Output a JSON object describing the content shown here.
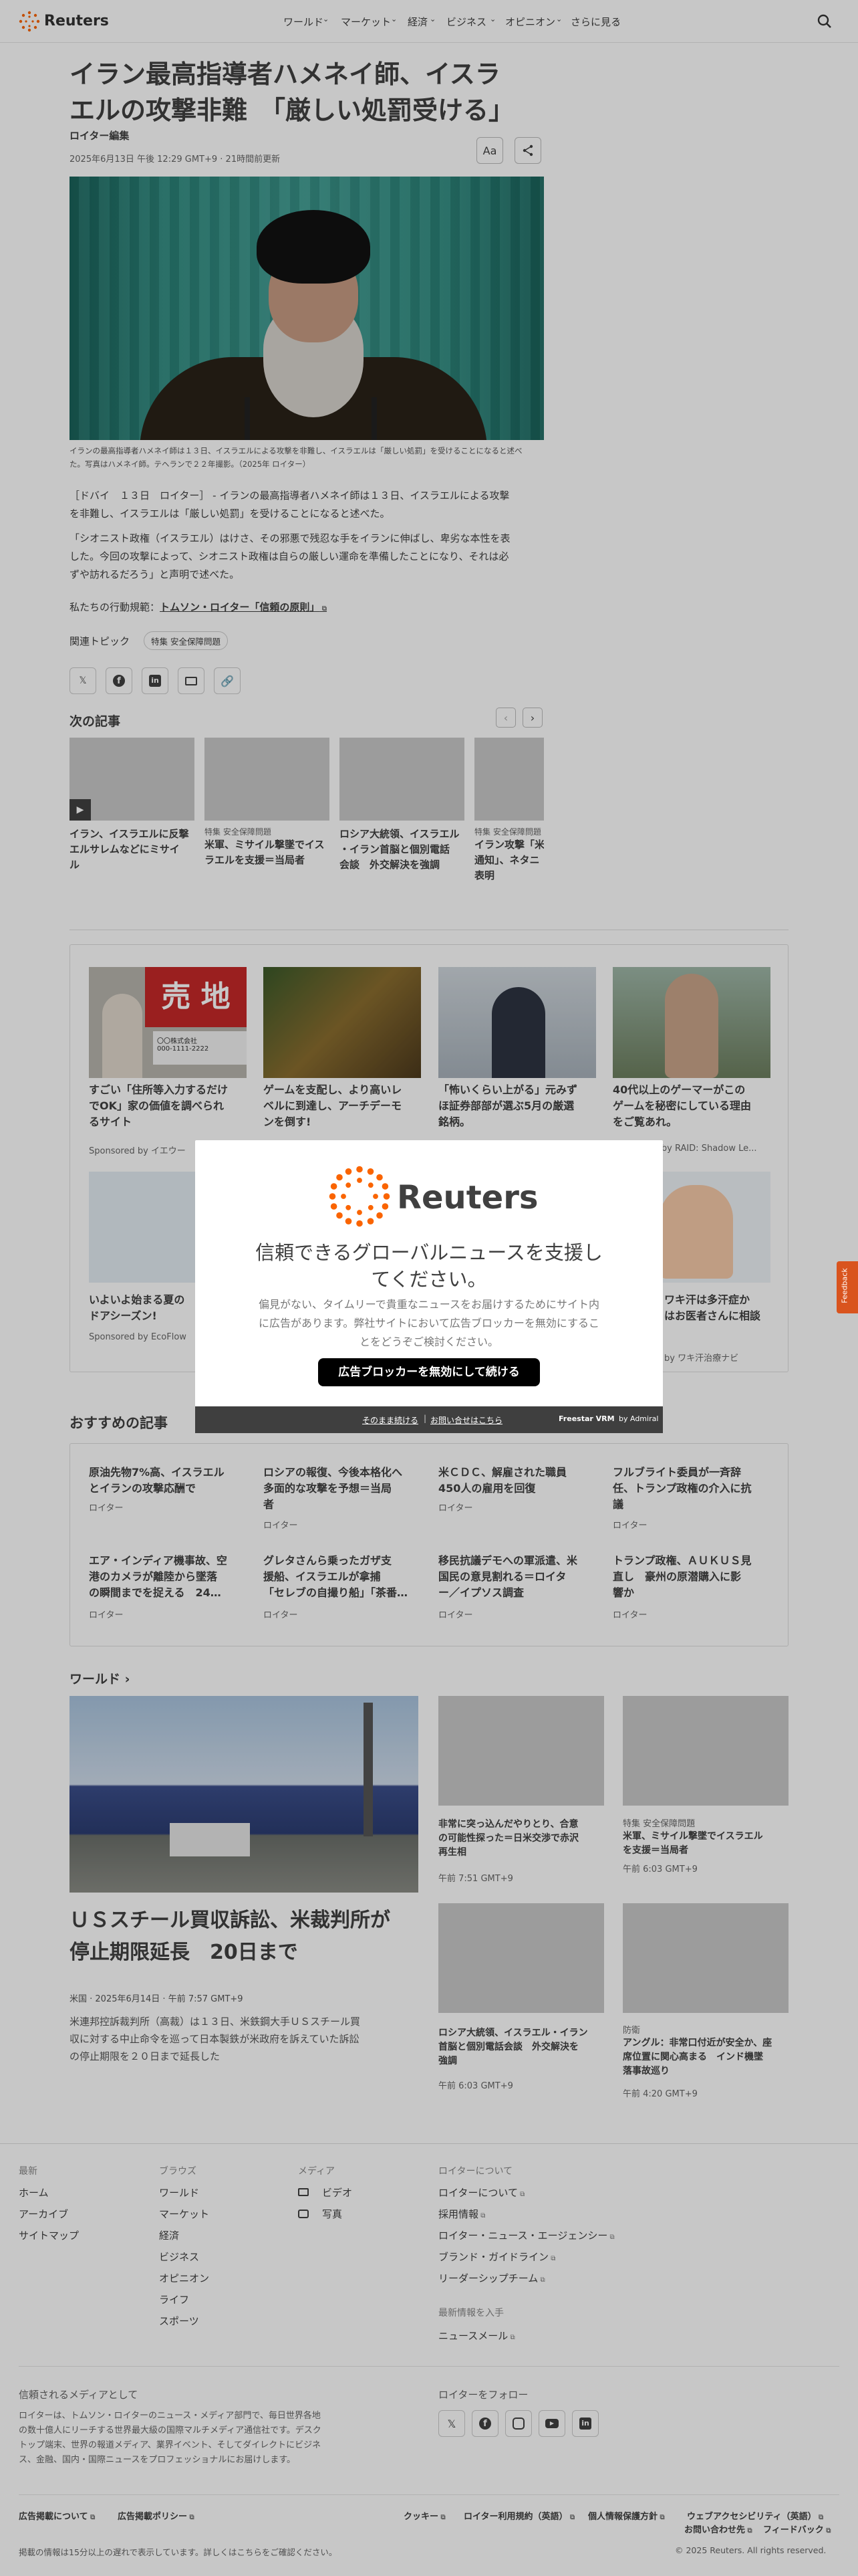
{
  "header": {
    "logo": "Reuters",
    "nav": [
      "ワールド",
      "マーケット",
      "経済",
      "ビジネス",
      "オピニオン",
      "さらに見る"
    ]
  },
  "article": {
    "title_line1": "イラン最高指導者ハメネイ師、イスラ",
    "title_line2": "エルの攻撃非難　「厳しい処罰受ける」",
    "byline": "ロイター編集",
    "date": "2025年6月13日 午後 12:29 GMT+9 · 21時間前更新",
    "font_btn": "Aa",
    "caption_line1": "イランの最高指導者ハメネイ師は１３日、イスラエルによる攻撃を非難し、イスラエルは「厳しい処罰」を受けることになると述べ",
    "caption_line2": "た。写真はハメネイ師。テヘランで２２年撮影。（2025年 ロイター）",
    "para1_line1": "［ドバイ　１３日　ロイター］ - イランの最高指導者ハメネイ師は１３日、イスラエルによる攻撃",
    "para1_line2": "を非難し、イスラエルは「厳しい処罰」を受けることになると述べた。",
    "para2_line1": "「シオニスト政権（イスラエル）はけさ、その邪悪で残忍な手をイランに伸ばし、卑劣な本性を表",
    "para2_line2": "した。今回の攻撃によって、シオニスト政権は自らの厳しい運命を準備したことになり、それは必",
    "para2_line3": "ずや訪れるだろう」と声明で述べた。",
    "principles_prefix": "私たちの行動規範：",
    "principles_link": "トムソン・ロイター「信頼の原則」",
    "topics_label": "関連トピック",
    "topic_tag": "特集 安全保障問題"
  },
  "next": {
    "heading": "次の記事",
    "items": [
      {
        "kicker": "",
        "title1": "イラン、イスラエルに反撃",
        "title2": "エルサレムなどにミサイ",
        "title3": "ル"
      },
      {
        "kicker": "特集 安全保障問題",
        "title1": "米軍、ミサイル撃墜でイス",
        "title2": "ラエルを支援＝当局者",
        "title3": ""
      },
      {
        "kicker": "",
        "title1": "ロシア大統領、イスラエル",
        "title2": "・イラン首脳と個別電話",
        "title3": "会談　外交解決を強調"
      },
      {
        "kicker": "特集 安全保障問題",
        "title1": "イラン攻撃「米",
        "title2": "通知」、ネタニ",
        "title3": "表明"
      }
    ]
  },
  "ads": [
    {
      "title1": "すごい「住所等入力するだけ",
      "title2": "でOK」家の価値を調べられ",
      "title3": "るサイト",
      "sponsor": "Sponsored by イエウー"
    },
    {
      "title1": "ゲームを支配し、より高いレ",
      "title2": "ベルに到達し、アーチデーモ",
      "title3": "ンを倒す!",
      "sponsor": ""
    },
    {
      "title1": "「怖いくらい上がる」元みず",
      "title2": "ほ証券部部が選ぶ5月の厳選",
      "title3": "銘柄。",
      "sponsor": ""
    },
    {
      "title1": "40代以上のゲーマーがこの",
      "title2": "ゲームを秘密にしている理由",
      "title3": "をご覧あれ。",
      "sponsor": "Sponsored by RAID: Shadow Le..."
    },
    {
      "title1": "いよいよ始まる夏の",
      "title2": "ドアシーズン!",
      "title3": "",
      "sponsor": "Sponsored by EcoFlow"
    },
    {
      "title1": "",
      "title2": "",
      "title3": "",
      "sponsor": ""
    },
    {
      "title1": "",
      "title2": "",
      "title3": "",
      "sponsor": ""
    },
    {
      "title1": "ワキ汗は多汗症か",
      "title2": "はお医者さんに相談",
      "title3": "",
      "sponsor": "by ワキ汗治療ナビ"
    }
  ],
  "ad_sign": "売 地",
  "ad_phone": "000-1111-2222",
  "ad_company": "〇〇株式会社",
  "recommended": {
    "heading": "おすすめの記事",
    "items": [
      {
        "t1": "原油先物7%高、イスラエル",
        "t2": "とイランの攻撃応酬で",
        "src": "ロイター"
      },
      {
        "t1": "ロシアの報復、今後本格化へ",
        "t2": "多面的な攻撃を予想＝当局",
        "t3": "者",
        "src": "ロイター"
      },
      {
        "t1": "米ＣＤＣ、解雇された職員",
        "t2": "450人の雇用を回復",
        "src": "ロイター"
      },
      {
        "t1": "フルブライト委員が一斉辞",
        "t2": "任、トランプ政権の介入に抗",
        "t3": "議",
        "src": "ロイター"
      },
      {
        "t1": "エア・インディア機事故、空",
        "t2": "港のカメラが離陸から墜落",
        "t3": "の瞬間までを捉える　24…",
        "src": "ロイター"
      },
      {
        "t1": "グレタさんら乗ったガザ支",
        "t2": "援船、イスラエルが拿捕",
        "t3": "「セレブの自撮り船」「茶番…",
        "src": "ロイター"
      },
      {
        "t1": "移民抗議デモへの軍派遣、米",
        "t2": "国民の意見割れる＝ロイタ",
        "t3": "ー／イプソス調査",
        "src": "ロイター"
      },
      {
        "t1": "トランプ政権、ＡＵＫＵＳ見",
        "t2": "直し　豪州の原潜購入に影",
        "t3": "響か",
        "src": "ロイター"
      }
    ]
  },
  "world": {
    "heading": "ワールド",
    "lead_title1": "ＵＳスチール買収訴訟、米裁判所が",
    "lead_title2": "停止期限延長　20日まで",
    "lead_meta": "米国 · 2025年6月14日 · 午前 7:57 GMT+9",
    "lead_desc1": "米連邦控訴裁判所（高裁）は１３日、米鉄鋼大手ＵＳスチール買",
    "lead_desc2": "収に対する中止命令を巡って日本製鉄が米政府を訴えていた訴訟",
    "lead_desc3": "の停止期限を２０日まで延長した",
    "cards": [
      {
        "kicker": "",
        "t1": "非常に突っ込んだやりとり、合意",
        "t2": "の可能性探った＝日米交渉で赤沢",
        "t3": "再生相",
        "time": "午前 7:51 GMT+9"
      },
      {
        "kicker": "特集 安全保障問題",
        "t1": "米軍、ミサイル撃墜でイスラエル",
        "t2": "を支援＝当局者",
        "t3": "",
        "time": "午前 6:03 GMT+9"
      },
      {
        "kicker": "",
        "t1": "ロシア大統領、イスラエル・イラン",
        "t2": "首脳と個別電話会談　外交解決を",
        "t3": "強調",
        "time": "午前 6:03 GMT+9"
      },
      {
        "kicker": "防衛",
        "t1": "アングル：非常口付近が安全か、座",
        "t2": "席位置に関心高まる　インド機墜",
        "t3": "落事故巡り",
        "time": "午前 4:20 GMT+9"
      }
    ]
  },
  "footer": {
    "col1": {
      "head": "最新",
      "links": [
        "ホーム",
        "アーカイブ",
        "サイトマップ"
      ]
    },
    "col2": {
      "head": "ブラウズ",
      "links": [
        "ワールド",
        "マーケット",
        "経済",
        "ビジネス",
        "オピニオン",
        "ライフ",
        "スポーツ"
      ]
    },
    "col3": {
      "head": "メディア",
      "links": [
        "ビデオ",
        "写真"
      ]
    },
    "col4": {
      "head": "ロイターについて",
      "links": [
        "ロイターについて",
        "採用情報",
        "ロイター・ニュース・エージェンシー",
        "ブランド・ガイドライン",
        "リーダーシップチーム"
      ]
    },
    "latest_head": "最新情報を入手",
    "newsletter": "ニュースメール",
    "trusted_head": "信頼されるメディアとして",
    "trusted1": "ロイターは、トムソン・ロイターのニュース・メディア部門で、毎日世界各地",
    "trusted2": "の数十億人にリーチする世界最大級の国際マルチメディア通信社です。デスク",
    "trusted3": "トップ端末、世界の報道メディア、業界イベント、そしてダイレクトにビジネ",
    "trusted4": "ス、金融、国内・国際ニュースをプロフェッショナルにお届けします。",
    "follow_head": "ロイターをフォロー",
    "bottom_left": [
      "広告掲載について",
      "広告掲載ポリシー"
    ],
    "bottom_right": [
      "クッキー",
      "ロイター利用規約（英語）",
      "個人情報保護方針",
      "ウェブアクセシビリティ（英語）"
    ],
    "contact": "お問い合わせ先",
    "feedback": "フィードバック",
    "delay_note": "掲載の情報は15分以上の遅れで表示しています。詳しくはこちらをご確認ください。",
    "copyright": "© 2025 Reuters. All rights reserved."
  },
  "modal": {
    "logo": "Reuters",
    "headline1": "信頼できるグローバルニュースを支援し",
    "headline2": "てください。",
    "body1": "偏見がない、タイムリーで貴重なニュースをお届けするためにサイト内",
    "body2": "に広告があります。弊社サイトにおいて広告ブロッカーを無効にするこ",
    "body3": "とをどうぞご検討ください。",
    "button": "広告ブロッカーを無効にして続ける",
    "continue_link": "そのまま続ける",
    "contact_link": "お問い合せはこちら",
    "powered": "Freestar VRM",
    "by": "by Admiral"
  },
  "feedback_tab": "Feedback"
}
